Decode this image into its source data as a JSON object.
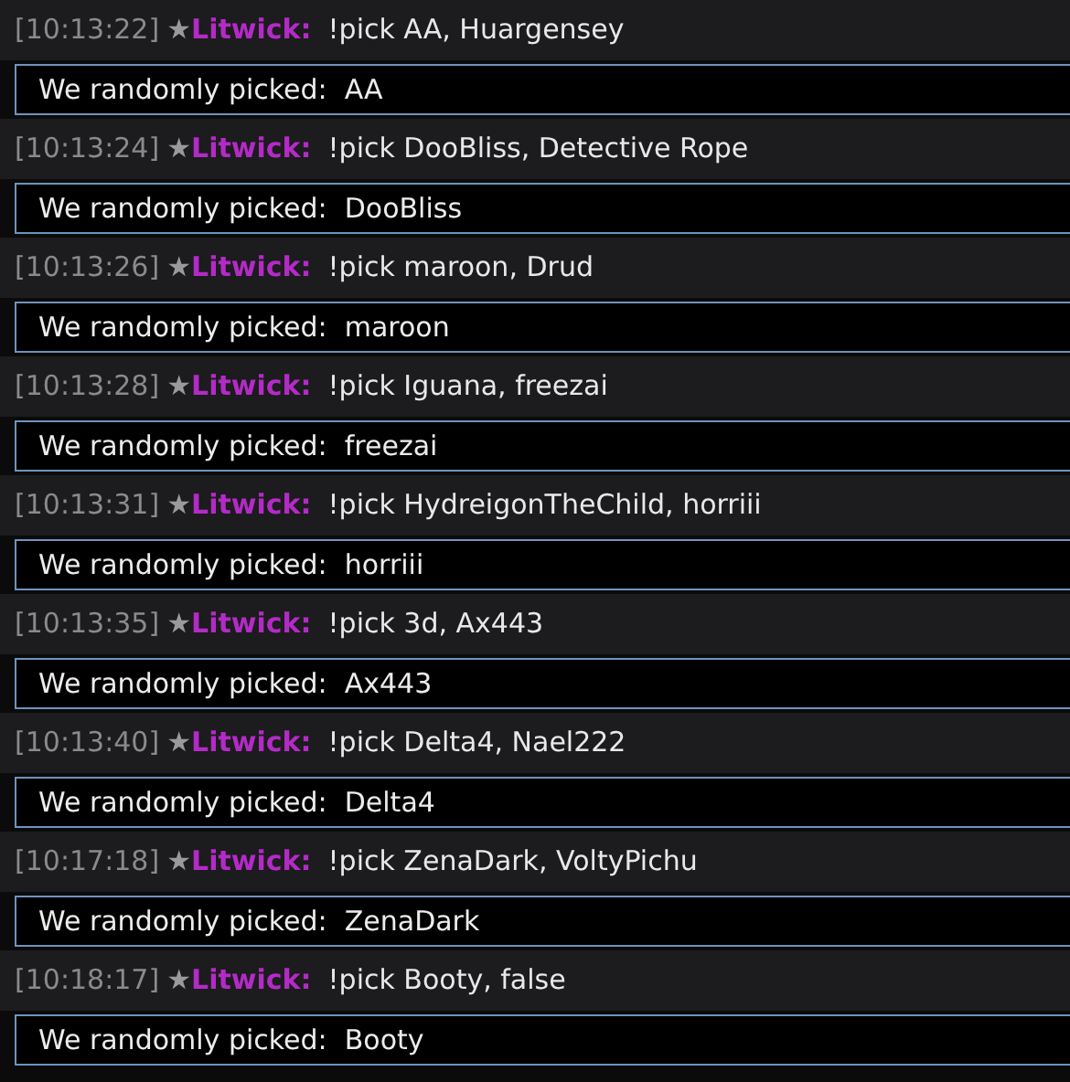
{
  "messages": [
    {
      "time": "[10:13:22]",
      "rank": "★",
      "user": "Litwick:",
      "text": "!pick AA, Huargensey",
      "result": "We randomly picked:  AA"
    },
    {
      "time": "[10:13:24]",
      "rank": "★",
      "user": "Litwick:",
      "text": "!pick DooBliss, Detective Rope",
      "result": "We randomly picked:  DooBliss"
    },
    {
      "time": "[10:13:26]",
      "rank": "★",
      "user": "Litwick:",
      "text": "!pick maroon, Drud",
      "result": "We randomly picked:  maroon"
    },
    {
      "time": "[10:13:28]",
      "rank": "★",
      "user": "Litwick:",
      "text": "!pick Iguana, freezai",
      "result": "We randomly picked:  freezai"
    },
    {
      "time": "[10:13:31]",
      "rank": "★",
      "user": "Litwick:",
      "text": "!pick HydreigonTheChild, horriii",
      "result": "We randomly picked:  horriii"
    },
    {
      "time": "[10:13:35]",
      "rank": "★",
      "user": "Litwick:",
      "text": "!pick 3d, Ax443",
      "result": "We randomly picked:  Ax443"
    },
    {
      "time": "[10:13:40]",
      "rank": "★",
      "user": "Litwick:",
      "text": "!pick Delta4, Nael222",
      "result": "We randomly picked:  Delta4"
    },
    {
      "time": "[10:17:18]",
      "rank": "★",
      "user": "Litwick:",
      "text": "!pick ZenaDark, VoltyPichu",
      "result": "We randomly picked:  ZenaDark"
    },
    {
      "time": "[10:18:17]",
      "rank": "★",
      "user": "Litwick:",
      "text": "!pick Booty, false",
      "result": "We randomly picked:  Booty"
    }
  ]
}
